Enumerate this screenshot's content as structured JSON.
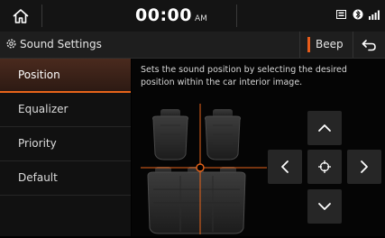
{
  "status_bar": {
    "time": "00:00",
    "ampm": "AM",
    "icons": [
      "home-icon",
      "media-icon",
      "bluetooth-icon",
      "signal-icon"
    ]
  },
  "title_bar": {
    "title": "Sound Settings",
    "beep_label": "Beep",
    "icons": [
      "gear-icon",
      "back-icon"
    ]
  },
  "sidebar": {
    "items": [
      {
        "label": "Position",
        "active": true
      },
      {
        "label": "Equalizer",
        "active": false
      },
      {
        "label": "Priority",
        "active": false
      },
      {
        "label": "Default",
        "active": false
      }
    ]
  },
  "main": {
    "description": "Sets the sound position by selecting the desired position within the car interior image."
  },
  "colors": {
    "accent": "#e8641a",
    "crosshair": "#e8641a",
    "background": "#000000",
    "button": "#262626"
  }
}
